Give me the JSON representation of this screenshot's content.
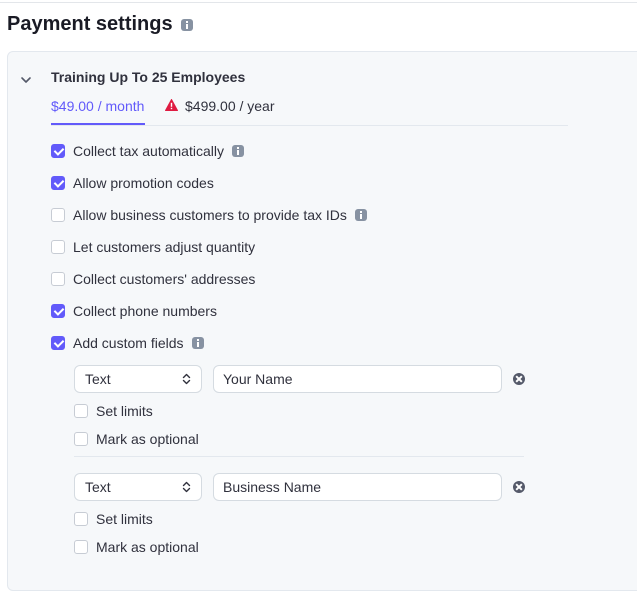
{
  "title": "Payment settings",
  "plan": {
    "name": "Training Up To 25 Employees",
    "tabs": [
      {
        "label": "$49.00 / month",
        "active": true
      },
      {
        "label": "$499.00 / year",
        "active": false,
        "warning": true
      }
    ]
  },
  "options": [
    {
      "label": "Collect tax automatically",
      "checked": true,
      "info": true
    },
    {
      "label": "Allow promotion codes",
      "checked": true,
      "info": false
    },
    {
      "label": "Allow business customers to provide tax IDs",
      "checked": false,
      "info": true
    },
    {
      "label": "Let customers adjust quantity",
      "checked": false,
      "info": false
    },
    {
      "label": "Collect customers' addresses",
      "checked": false,
      "info": false
    },
    {
      "label": "Collect phone numbers",
      "checked": true,
      "info": false
    },
    {
      "label": "Add custom fields",
      "checked": true,
      "info": true
    }
  ],
  "custom_fields": [
    {
      "type": "Text",
      "label_value": "Your Name",
      "set_limits_label": "Set limits",
      "set_limits": false,
      "optional_label": "Mark as optional",
      "optional": false
    },
    {
      "type": "Text",
      "label_value": "Business Name",
      "set_limits_label": "Set limits",
      "set_limits": false,
      "optional_label": "Mark as optional",
      "optional": false
    }
  ],
  "colors": {
    "accent": "#625afa",
    "warning": "#df1b41",
    "panel_bg": "#f6f8fa"
  }
}
